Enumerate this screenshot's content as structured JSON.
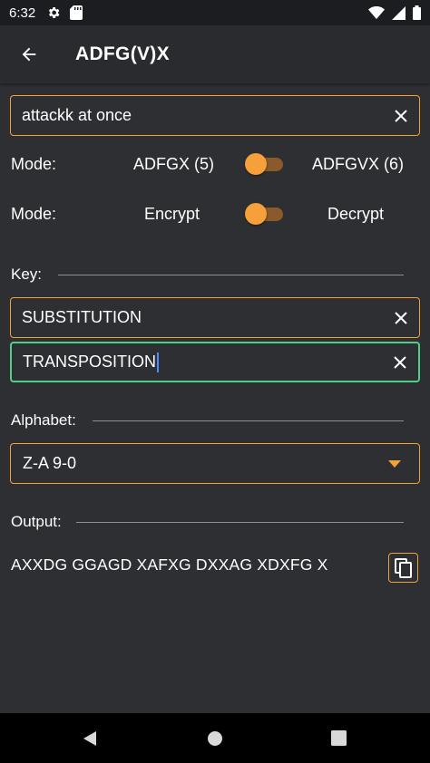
{
  "status_bar": {
    "time": "6:32",
    "left_icons": [
      "settings-gear",
      "sd-card"
    ],
    "right_icons": [
      "wifi",
      "signal",
      "battery"
    ]
  },
  "app_bar": {
    "title": "ADFG(V)X",
    "back_icon": "arrow-back"
  },
  "input": {
    "value": "attackk at once",
    "clear_icon": "close"
  },
  "mode_cipher": {
    "label": "Mode:",
    "option_off": "ADFGX (5)",
    "option_on": "ADFGVX (6)"
  },
  "mode_direction": {
    "label": "Mode:",
    "option_off": "Encrypt",
    "option_on": "Decrypt"
  },
  "key": {
    "header": "Key:",
    "substitution": "SUBSTITUTION",
    "transposition": "TRANSPOSITION"
  },
  "alphabet": {
    "header": "Alphabet:",
    "selected": "Z-A 9-0"
  },
  "output": {
    "header": "Output:",
    "value": "AXXDG GGAGD XAFXG DXXAG XDXFG X",
    "copy_icon": "content-copy"
  },
  "nav_bar": {
    "icons": [
      "back-triangle",
      "home-circle",
      "recents-square"
    ]
  },
  "colors": {
    "background": "#2e2f33",
    "accent": "#f5a03a",
    "focus": "#4fd08a",
    "text": "#ffffff"
  }
}
